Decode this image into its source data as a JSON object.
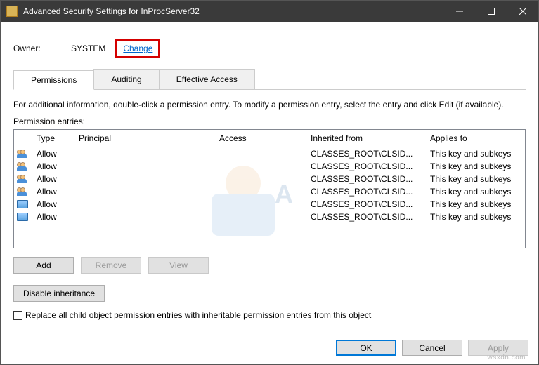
{
  "window": {
    "title": "Advanced Security Settings for InProcServer32"
  },
  "owner": {
    "label": "Owner:",
    "value": "SYSTEM",
    "change": "Change"
  },
  "tabs": [
    {
      "label": "Permissions",
      "active": true
    },
    {
      "label": "Auditing",
      "active": false
    },
    {
      "label": "Effective Access",
      "active": false
    }
  ],
  "info_line": "For additional information, double-click a permission entry. To modify a permission entry, select the entry and click Edit (if available).",
  "entries_label": "Permission entries:",
  "columns": {
    "type": "Type",
    "principal": "Principal",
    "access": "Access",
    "inherited": "Inherited from",
    "applies": "Applies to"
  },
  "rows": [
    {
      "icon": "group",
      "type": "Allow",
      "principal": "",
      "access": "",
      "inherited": "CLASSES_ROOT\\CLSID...",
      "applies": "This key and subkeys"
    },
    {
      "icon": "group",
      "type": "Allow",
      "principal": "",
      "access": "",
      "inherited": "CLASSES_ROOT\\CLSID...",
      "applies": "This key and subkeys"
    },
    {
      "icon": "group",
      "type": "Allow",
      "principal": "",
      "access": "",
      "inherited": "CLASSES_ROOT\\CLSID...",
      "applies": "This key and subkeys"
    },
    {
      "icon": "group",
      "type": "Allow",
      "principal": "",
      "access": "",
      "inherited": "CLASSES_ROOT\\CLSID...",
      "applies": "This key and subkeys"
    },
    {
      "icon": "key",
      "type": "Allow",
      "principal": "",
      "access": "",
      "inherited": "CLASSES_ROOT\\CLSID...",
      "applies": "This key and subkeys"
    },
    {
      "icon": "key",
      "type": "Allow",
      "principal": "",
      "access": "",
      "inherited": "CLASSES_ROOT\\CLSID...",
      "applies": "This key and subkeys"
    }
  ],
  "buttons": {
    "add": "Add",
    "remove": "Remove",
    "view": "View",
    "disable_inh": "Disable inheritance",
    "ok": "OK",
    "cancel": "Cancel",
    "apply": "Apply"
  },
  "checkbox_label": "Replace all child object permission entries with inheritable permission entries from this object",
  "watermark_site": "wsxdn.com"
}
